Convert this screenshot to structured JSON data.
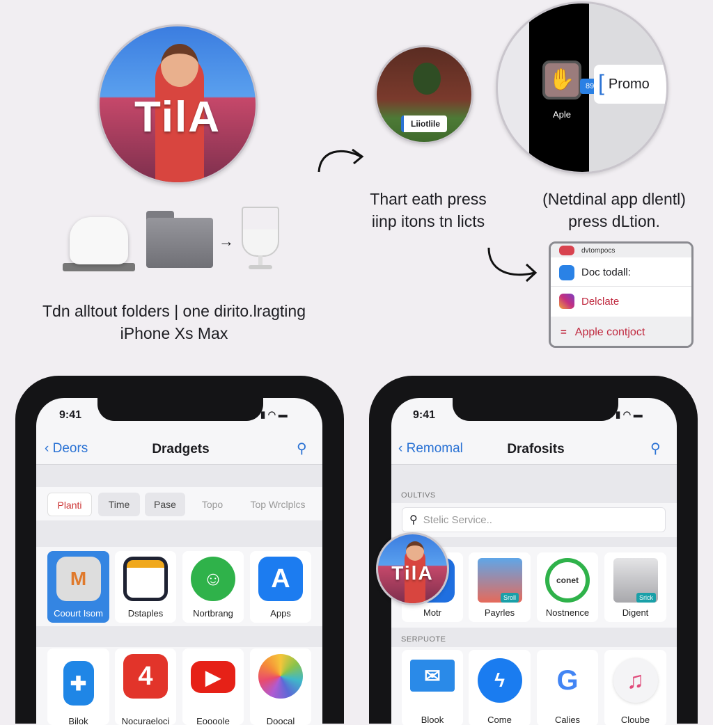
{
  "illustration": {
    "avatar_logo_text": "TilA",
    "photo_label": "Liiotlile",
    "zoom_icon_label": "Aple",
    "zoom_badge": "89fG8",
    "zoom_promo": "Promo",
    "caption_center": [
      "Thart eath press",
      "iinp itons tn licts"
    ],
    "caption_right": [
      "(Netdinal app dlentl)",
      "press dLtion."
    ],
    "caption_left": [
      "Tdn alltout folders | one dirito.lragting",
      "iPhone Xs Max"
    ]
  },
  "context_menu": {
    "items": [
      {
        "label": "dvtompocs",
        "color": "#d23a4a",
        "icon": "heart-icon"
      },
      {
        "label": "Doc todall:",
        "color": "#1b1b1f",
        "icon": "cloud-app-icon"
      },
      {
        "label": "Delclate",
        "color": "#c02a40",
        "icon": "instagram-icon"
      },
      {
        "label": "Apple contjoct",
        "color": "#c02a40",
        "icon": "lines-icon"
      }
    ]
  },
  "phone_left": {
    "time": "9:41",
    "back_label": "Deors",
    "title": "Dradgets",
    "tabs": [
      "Planti",
      "Time",
      "Pase",
      "Topo",
      "Top Wrclplcs"
    ],
    "tiles_row1": [
      {
        "label": "Coourt Isom",
        "icon": "M"
      },
      {
        "label": "Dstaples",
        "icon": ""
      },
      {
        "label": "Nortbrang",
        "icon": ""
      },
      {
        "label": "Apps",
        "icon": "A"
      }
    ],
    "tiles_row2": [
      {
        "label": "Bilok"
      },
      {
        "label": "Nocuraeloci",
        "icon": "4"
      },
      {
        "label": "Eoooole"
      },
      {
        "label": "Doocal"
      }
    ]
  },
  "phone_right": {
    "time": "9:41",
    "back_label": "Remomal",
    "title": "Drafosits",
    "section1": "OULTIVS",
    "search_placeholder": "Stelic Service..",
    "tiles_row1": [
      {
        "label": "Motr"
      },
      {
        "label": "Payrles",
        "badge": "Sroll"
      },
      {
        "label": "Nostnence",
        "icon": "conet"
      },
      {
        "label": "Digent",
        "badge": "Srick"
      }
    ],
    "section2": "SERPUOTE",
    "tiles_row2": [
      {
        "label": "Blook"
      },
      {
        "label": "Come"
      },
      {
        "label": "Calies",
        "icon": "G"
      },
      {
        "label": "Cloube",
        "icon": "♫"
      }
    ]
  },
  "colors": {
    "accent": "#2a72d4",
    "background": "#f1eef2",
    "destructive": "#c02a40"
  }
}
